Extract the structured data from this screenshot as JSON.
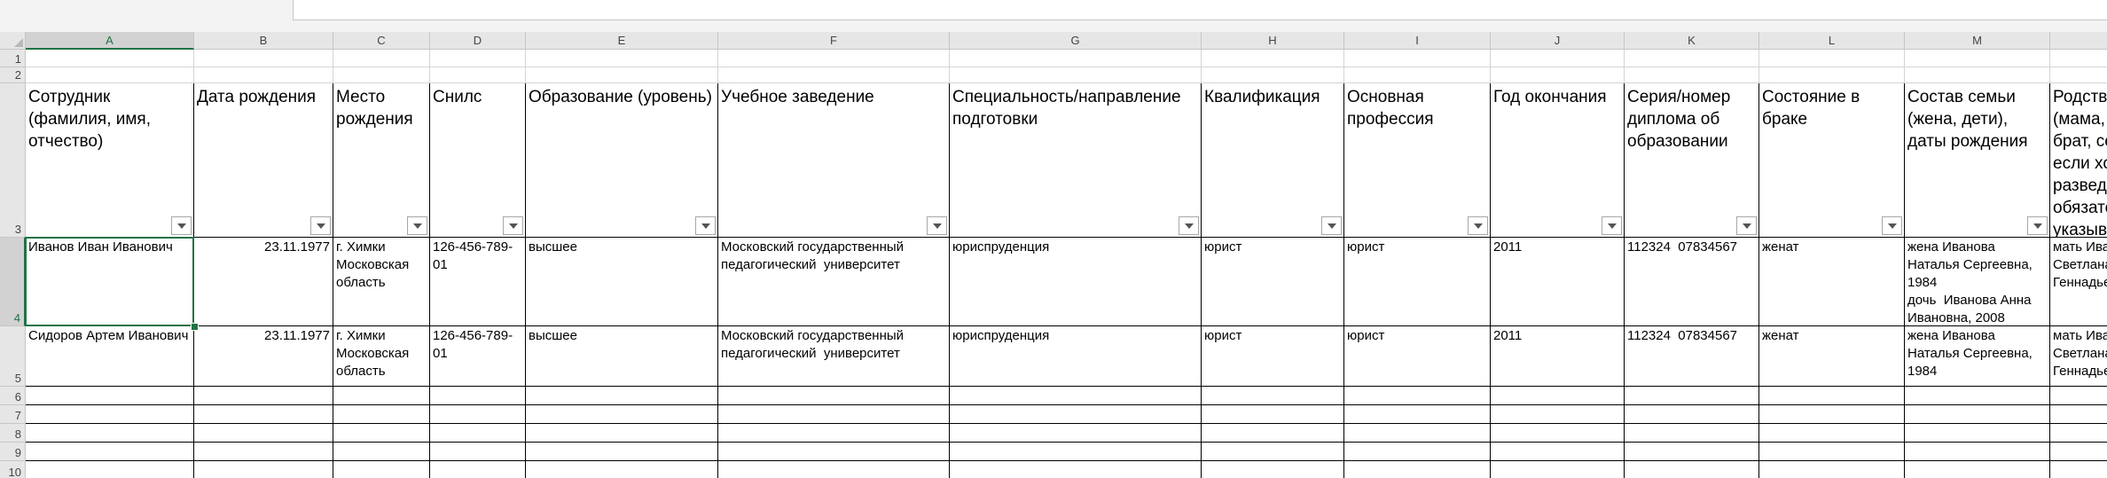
{
  "columns": [
    "A",
    "B",
    "C",
    "D",
    "E",
    "F",
    "G",
    "H",
    "I",
    "J",
    "K",
    "L",
    "M",
    ""
  ],
  "active_column": "A",
  "active_row": "4",
  "rows": [
    "1",
    "2",
    "3",
    "4",
    "5",
    "6",
    "7",
    "8",
    "9",
    "10"
  ],
  "headers": [
    "Сотрудник (фамилия, имя, отчество)",
    "Дата рождения",
    "Место рождения",
    "Снилс",
    "Образование (уровень)",
    "Учебное заведение",
    "Специальность/направление подготовки",
    "Квалификация",
    "Основная профессия",
    "Год окончания",
    "Серия/номер диплома об образовании",
    "Состояние в браке",
    "Состав семьи (жена, дети), даты рождения",
    "Родственники (мама, папа, брат, сестра, если холост, разведен обязательно указывать)"
  ],
  "records": [
    [
      "Иванов Иван Иванович",
      "23.11.1977",
      "г. Химки Московская область",
      "126-456-789-01",
      "высшее",
      "Московский государственный педагогический  университет",
      "юриспруденция",
      "юрист",
      "юрист",
      "2011",
      "112324  07834567",
      "женат",
      "жена Иванова Наталья Сергеевна, 1984\nдочь  Иванова Анна Ивановна, 2008",
      "мать Иванова Светлана Геннадьевна"
    ],
    [
      "Сидоров Артем Иванович",
      "23.11.1977",
      "г. Химки Московская область",
      "126-456-789-01",
      "высшее",
      "Московский государственный педагогический  университет",
      "юриспруденция",
      "юрист",
      "юрист",
      "2011",
      "112324  07834567",
      "женат",
      "жена Иванова Наталья Сергеевна, 1984",
      "мать Иванова Светлана Геннадьевна"
    ]
  ]
}
